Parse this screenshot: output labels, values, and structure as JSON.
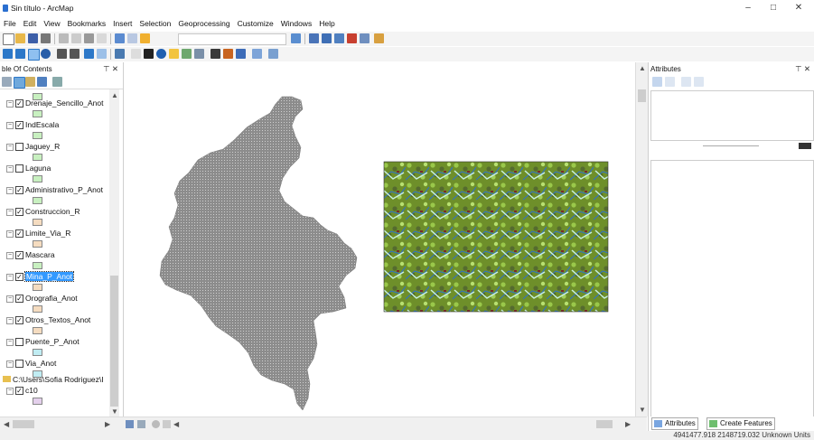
{
  "window": {
    "title": "Sin título - ArcMap",
    "controls": [
      "–",
      "□",
      "✕"
    ]
  },
  "menu": [
    "File",
    "Edit",
    "View",
    "Bookmarks",
    "Insert",
    "Selection",
    "Geoprocessing",
    "Customize",
    "Windows",
    "Help"
  ],
  "toc": {
    "title": "ble Of Contents",
    "layers": [
      {
        "name": "Drenaje_Sencillo_Anot",
        "checked": true,
        "swatch": "#c8f0c0"
      },
      {
        "name": "IndEscala",
        "checked": true,
        "swatch": "#c8f0c0"
      },
      {
        "name": "Jaguey_R",
        "checked": false,
        "swatch": "#c8f0c0"
      },
      {
        "name": "Laguna",
        "checked": false,
        "swatch": "#c8f0c0"
      },
      {
        "name": "Administrativo_P_Anot",
        "checked": true,
        "swatch": "#c8f0c0"
      },
      {
        "name": "Construccion_R",
        "checked": true,
        "swatch": "#f5dcc0"
      },
      {
        "name": "Limite_Via_R",
        "checked": true,
        "swatch": "#f5dcc0"
      },
      {
        "name": "Mascara",
        "checked": true,
        "swatch": "#c8f0c0"
      },
      {
        "name": "Mina_P_Anot",
        "checked": true,
        "selected": true,
        "swatch": "#f5dcc0"
      },
      {
        "name": "Orografia_Anot",
        "checked": true,
        "swatch": "#f5dcc0"
      },
      {
        "name": "Otros_Textos_Anot",
        "checked": true,
        "swatch": "#f5dcc0"
      },
      {
        "name": "Puente_P_Anot",
        "checked": false,
        "swatch": "#c0ecf2"
      },
      {
        "name": "Via_Anot",
        "checked": false,
        "swatch": "#c0ecf2"
      }
    ],
    "path_item": "C:\\Users\\Sofia Rodriguez\\I",
    "raster_layer": {
      "name": "c10",
      "checked": true,
      "swatch": "#e4d0ec"
    }
  },
  "attributes": {
    "title": "Attributes",
    "tab_attributes": "Attributes",
    "tab_create_features": "Create Features"
  },
  "status": {
    "coordinates": "4941477.918  2148719.032 Unknown Units"
  },
  "colors": {
    "selection": "#3399ff",
    "country_fill": "#888888",
    "raster_green": "#6b8e23"
  }
}
